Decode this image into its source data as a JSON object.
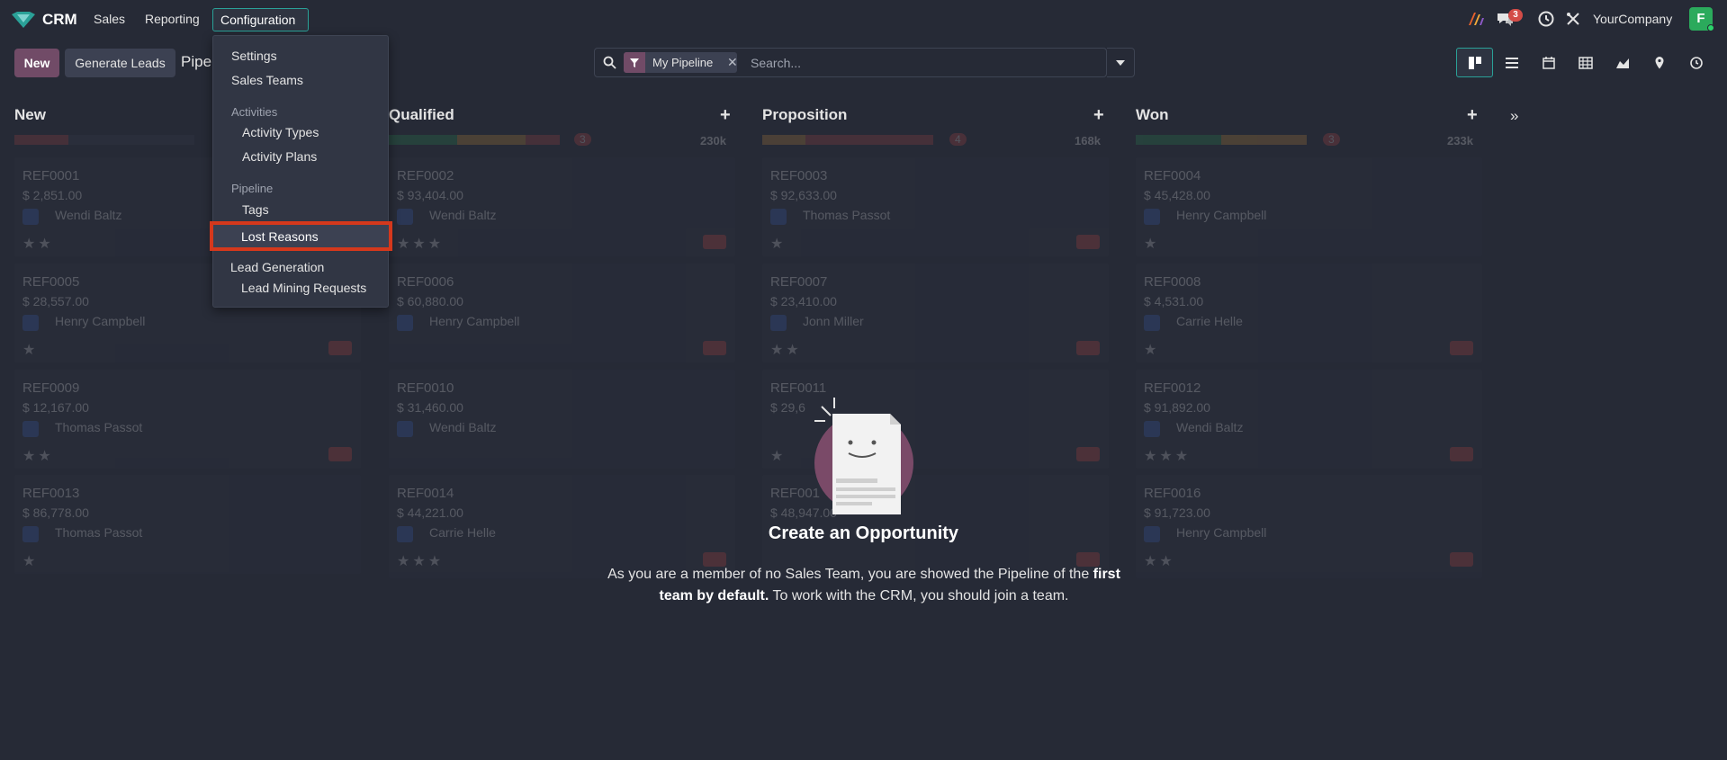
{
  "navbar": {
    "app_name": "CRM",
    "menu": [
      "Sales",
      "Reporting",
      "Configuration"
    ],
    "notification_count": "3",
    "company": "YourCompany",
    "avatar_letter": "F"
  },
  "control_panel": {
    "new_label": "New",
    "generate_leads_label": "Generate Leads",
    "breadcrumb": "Pipel",
    "facet_label": "My Pipeline",
    "search_placeholder": "Search..."
  },
  "views": [
    "kanban-icon",
    "list-icon",
    "calendar-icon",
    "pivot-icon",
    "graph-icon",
    "map-icon",
    "activity-icon"
  ],
  "columns": [
    {
      "title": "New",
      "count": "",
      "total": ""
    },
    {
      "title": "Qualified",
      "count": "3",
      "total": "230k"
    },
    {
      "title": "Proposition",
      "count": "4",
      "total": "168k"
    },
    {
      "title": "Won",
      "count": "3",
      "total": "233k"
    }
  ],
  "cards": [
    {
      "ref": "REF0001",
      "amount": "$ 2,851.00",
      "who": "Wendi Baltz"
    },
    {
      "ref": "REF0005",
      "amount": "$ 28,557.00",
      "who": "Henry Campbell"
    },
    {
      "ref": "REF0009",
      "amount": "$ 12,167.00",
      "who": "Thomas Passot"
    },
    {
      "ref": "REF0013",
      "amount": "$ 86,778.00",
      "who": "Thomas Passot"
    },
    {
      "ref": "REF0002",
      "amount": "$ 93,404.00",
      "who": "Wendi Baltz"
    },
    {
      "ref": "REF0006",
      "amount": "$ 60,880.00",
      "who": "Henry Campbell"
    },
    {
      "ref": "REF0010",
      "amount": "$ 31,460.00",
      "who": "Wendi Baltz"
    },
    {
      "ref": "REF0014",
      "amount": "$ 44,221.00",
      "who": "Carrie Helle"
    },
    {
      "ref": "REF0003",
      "amount": "$ 92,633.00",
      "who": "Thomas Passot"
    },
    {
      "ref": "REF0007",
      "amount": "$ 23,410.00",
      "who": "Jonn Miller"
    },
    {
      "ref": "REF0011",
      "amount": "$ 29,6",
      "who": ""
    },
    {
      "ref": "REF001",
      "amount": "$ 48,947.00",
      "who": ""
    },
    {
      "ref": "REF0004",
      "amount": "$ 45,428.00",
      "who": "Henry Campbell"
    },
    {
      "ref": "REF0008",
      "amount": "$ 4,531.00",
      "who": "Carrie Helle"
    },
    {
      "ref": "REF0012",
      "amount": "$ 91,892.00",
      "who": "Wendi Baltz"
    },
    {
      "ref": "REF0016",
      "amount": "$ 91,723.00",
      "who": "Henry Campbell"
    }
  ],
  "helper": {
    "title": "Create an Opportunity",
    "text_1": "As you are a member of no Sales Team, you are showed the Pipeline of the ",
    "text_bold": "first team by default.",
    "text_2": " To work with the CRM, you should join a team."
  },
  "dropdown": {
    "settings": "Settings",
    "sales_teams": "Sales Teams",
    "activities_header": "Activities",
    "activity_types": "Activity Types",
    "activity_plans": "Activity Plans",
    "pipeline_header": "Pipeline",
    "tags": "Tags",
    "lost_reasons": "Lost Reasons",
    "lead_gen_header": "Lead Generation",
    "lead_mining": "Lead Mining Requests"
  },
  "colors": {
    "accent": "#714B67",
    "teal": "#2AA198",
    "highlight": "#D5381C",
    "background": "#262A36"
  }
}
